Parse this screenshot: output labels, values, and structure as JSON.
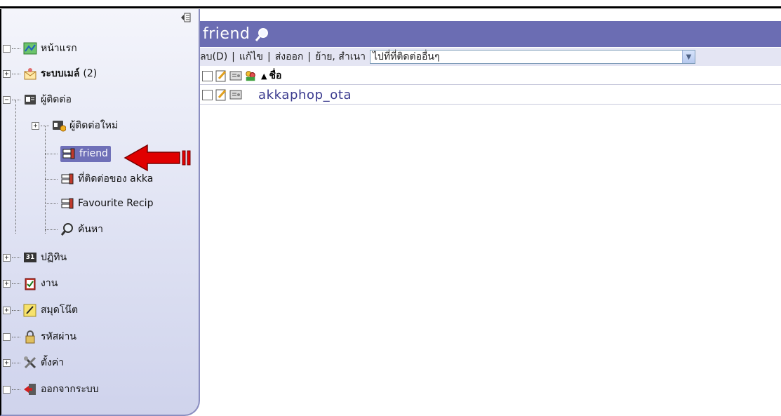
{
  "sidebar": {
    "collapse_icon": "collapse-pane-icon",
    "items": [
      {
        "label": "หน้าแรก",
        "icon": "home-map-icon"
      },
      {
        "label": "ระบบเมล์",
        "count": "(2)",
        "icon": "mail-icon"
      },
      {
        "label": "ผู้ติดต่อ",
        "icon": "contacts-icon"
      },
      {
        "label": "ผู้ติดต่อใหม่",
        "icon": "new-contact-icon"
      },
      {
        "label": "friend",
        "icon": "address-book-icon"
      },
      {
        "label": "ที่ติดต่อของ akka",
        "icon": "address-book-icon"
      },
      {
        "label": "Favourite Recip",
        "icon": "address-book-icon"
      },
      {
        "label": "ค้นหา",
        "icon": "search-icon"
      },
      {
        "label": "ปฏิทิน",
        "icon": "calendar-icon",
        "calendar_day": "31"
      },
      {
        "label": "งาน",
        "icon": "tasks-icon"
      },
      {
        "label": "สมุดโน๊ต",
        "icon": "notes-icon"
      },
      {
        "label": "รหัสผ่าน",
        "icon": "lock-icon"
      },
      {
        "label": "ตั้งค่า",
        "icon": "settings-tools-icon"
      },
      {
        "label": "ออกจากระบบ",
        "icon": "logout-icon"
      }
    ]
  },
  "main": {
    "title": "friend",
    "toolbar": {
      "delete": "ลบ(D)",
      "edit": "แก้ไข",
      "export": "ส่งออก",
      "move": "ย้าย, สำเนา",
      "goto_select": "ไปที่ที่ติดต่ออื่นๆ"
    },
    "table": {
      "sort_indicator": "▲",
      "name_header": "ชื่อ",
      "rows": [
        {
          "name": "akkaphop_ota"
        }
      ]
    }
  },
  "colors": {
    "title_bar": "#6b6db3",
    "selected": "#6f70b8",
    "arrow": "#e00000"
  }
}
